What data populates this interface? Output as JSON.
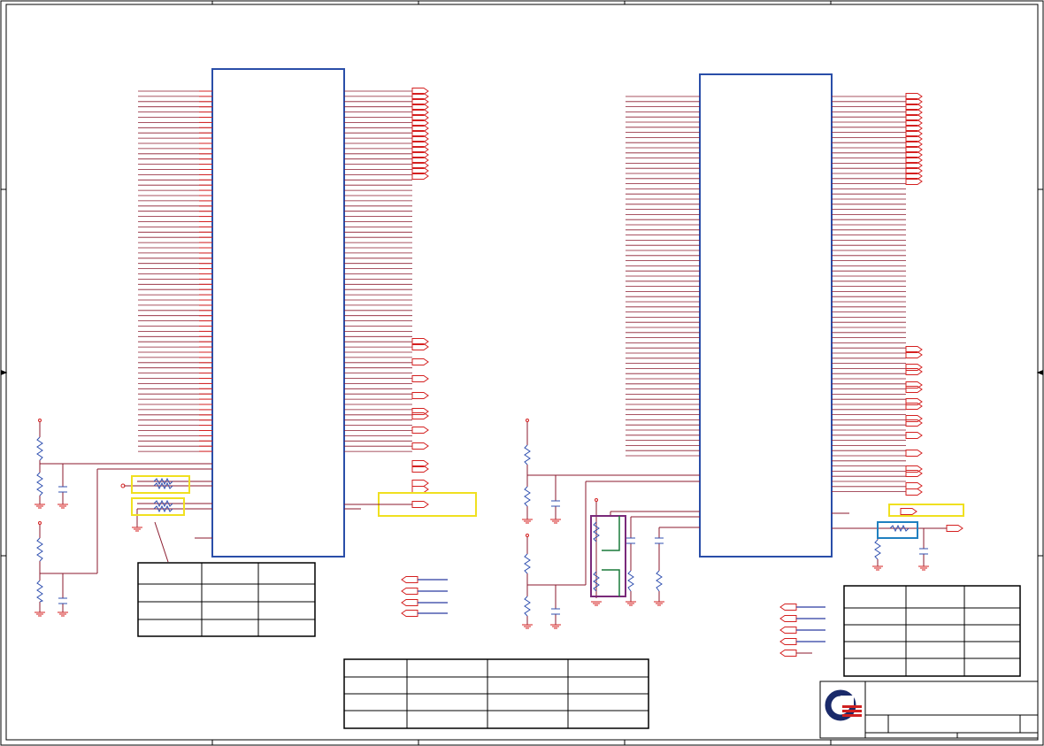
{
  "sheet": {
    "colors": {
      "border": "#000000",
      "ic_outline": "#2a4ea8",
      "wire": "#8b1a2e",
      "pin_red": "#d42020",
      "resistor_blue": "#3050b0",
      "highlight_yellow": "#f0e020",
      "highlight_purple": "#7a2a7a",
      "highlight_green": "#1a7a3a",
      "highlight_blue": "#2080c0",
      "net_wire_blue": "#2a3aa0",
      "logo_navy": "#1a2a6a",
      "logo_red": "#d02020"
    },
    "icons": [
      "border-arrow-left-icon",
      "border-arrow-right-icon",
      "company-logo-icon",
      "ground-symbol-icon",
      "capacitor-icon",
      "resistor-icon",
      "offpage-connector-icon"
    ]
  },
  "left_ic": {
    "label": "",
    "left_pins": 70,
    "right_connectors": 14
  },
  "right_ic": {
    "label": "",
    "left_pins": 72,
    "right_connectors": 17
  },
  "tables": {
    "left_table": {
      "rows": 4,
      "cols": 3
    },
    "center_table": {
      "rows": 4,
      "cols": 4
    },
    "right_table": {
      "rows": 5,
      "cols": 3
    }
  },
  "title_block": {
    "logo": "company-logo-icon",
    "title": "",
    "doc_number": "",
    "rev": "",
    "date": "",
    "sheet": ""
  }
}
